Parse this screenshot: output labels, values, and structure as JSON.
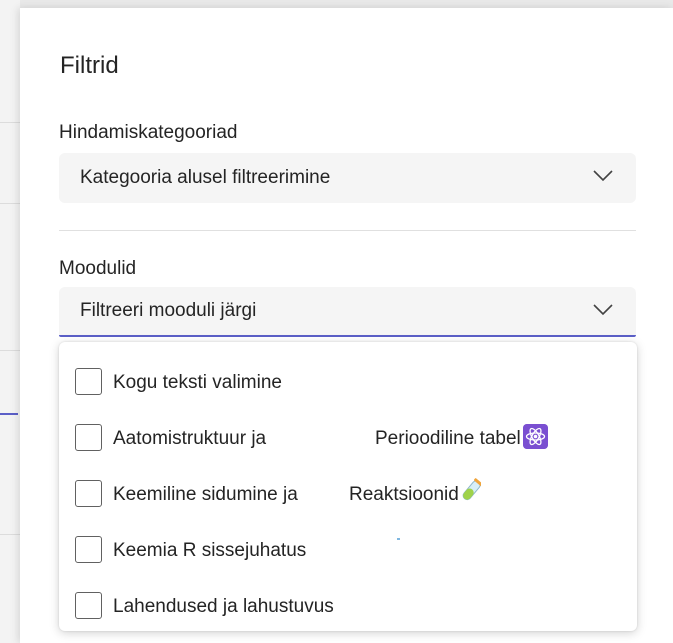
{
  "panel": {
    "title": "Filtrid"
  },
  "categories": {
    "label": "Hindamiskategooriad",
    "dropdown_value": "Kategooria alusel filtreerimine"
  },
  "modules": {
    "label": "Moodulid",
    "dropdown_value": "Filtreeri mooduli järgi",
    "options": [
      {
        "text": "Kogu teksti valimine",
        "checked": false
      },
      {
        "text": "Aatomistruktuur ja",
        "text2": "Perioodiline tabel",
        "emoji": "atom-icon",
        "checked": false
      },
      {
        "text": "Keemiline sidumine ja",
        "text2": "Reaktsioonid",
        "emoji": "test-tube-icon",
        "checked": false
      },
      {
        "text": "Keemia R sissejuhatus",
        "checked": false
      },
      {
        "text": "Lahendused ja lahustuvus",
        "checked": false
      }
    ]
  },
  "colors": {
    "accent": "#5b5fc7",
    "dropdown_bg": "#f5f5f5",
    "text": "#242424",
    "emoji_atom_bg": "#7a4fd1"
  }
}
